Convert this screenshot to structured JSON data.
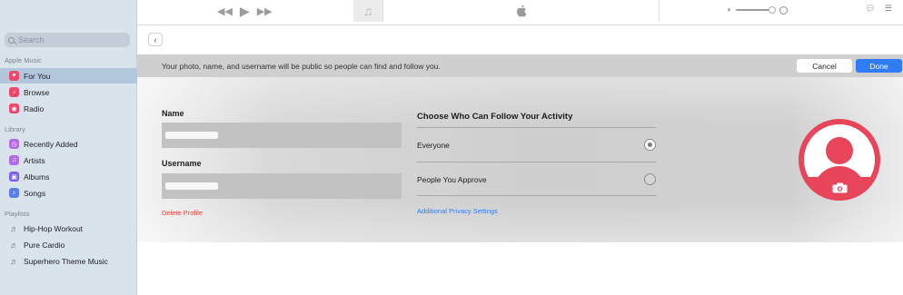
{
  "sidebar": {
    "search_placeholder": "Search",
    "apple_music_header": "Apple Music",
    "apple_music_items": [
      {
        "label": "For You",
        "icon": "heart-icon",
        "color": "#f0476a"
      },
      {
        "label": "Browse",
        "icon": "music-note-icon",
        "color": "#f0476a"
      },
      {
        "label": "Radio",
        "icon": "radio-icon",
        "color": "#f0476a"
      }
    ],
    "library_header": "Library",
    "library_items": [
      {
        "label": "Recently Added",
        "icon": "clock-icon",
        "color": "#b46ae8"
      },
      {
        "label": "Artists",
        "icon": "microphone-icon",
        "color": "#b46ae8"
      },
      {
        "label": "Albums",
        "icon": "album-icon",
        "color": "#7a62e8"
      },
      {
        "label": "Songs",
        "icon": "music-note-icon",
        "color": "#5b7de8"
      }
    ],
    "playlists_header": "Playlists",
    "playlist_items": [
      {
        "label": "Hip-Hop Workout",
        "icon": "playlist-icon"
      },
      {
        "label": "Pure Cardio",
        "icon": "playlist-icon"
      },
      {
        "label": "Superhero Theme Music",
        "icon": "playlist-icon"
      }
    ]
  },
  "toolbar": {
    "rewind_icon": "rewind-icon",
    "play_icon": "play-icon",
    "forward_icon": "fast-forward-icon",
    "artwork_icon": "music-note-icon",
    "lcd_icon": "apple-logo-icon",
    "volume_level": 0.9
  },
  "notice": {
    "text": "Your photo, name, and username will be public so people can find and follow you.",
    "cancel_label": "Cancel",
    "done_label": "Done"
  },
  "profile": {
    "name_label": "Name",
    "username_label": "Username",
    "delete_label": "Delete Profile",
    "follow_title": "Choose Who Can Follow Your Activity",
    "options": [
      {
        "label": "Everyone",
        "selected": true
      },
      {
        "label": "People You Approve",
        "selected": false
      }
    ],
    "privacy_link": "Additional Privacy Settings"
  },
  "colors": {
    "accent": "#2f7cf6",
    "destructive": "#e0453e",
    "avatar": "#e8445a"
  }
}
